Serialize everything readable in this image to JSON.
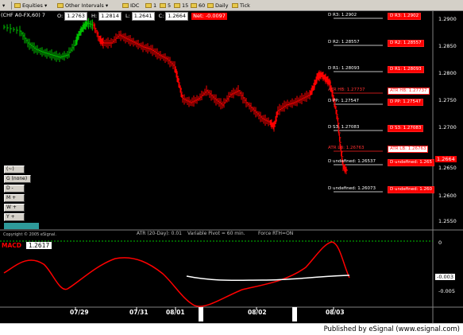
{
  "toolbar": {
    "equities": "Equities",
    "other_intervals": "Other Intervals",
    "intervals": [
      "IDC",
      "1",
      "5",
      "15",
      "60",
      "Daily",
      "Tick"
    ]
  },
  "symbol": {
    "title": "(CHF A0-FX,60) 7",
    "open_label": "O:",
    "open": "1.2763",
    "high_label": "H:",
    "high": "1.2814",
    "low_label": "L:",
    "low": "1.2641",
    "close_label": "C:",
    "close": "1.2664",
    "net_label": "Net:",
    "net": "-0.0097"
  },
  "levels": {
    "r3": {
      "label": "D R3:",
      "value": "1.2902",
      "tag": "D R3:  1.2902"
    },
    "r2": {
      "label": "D R2:",
      "value": "1.28557",
      "tag": "D R2: 1.28557"
    },
    "r1": {
      "label": "D R1:",
      "value": "1.28093",
      "tag": "D R1: 1.28093"
    },
    "atr_hb": {
      "label": "ATR HB:",
      "value": "1.27737",
      "tag": "ATR HB: 1.27737"
    },
    "pp": {
      "label": "D PP:",
      "value": "1.27547",
      "tag": "D PP: 1.27547"
    },
    "s3": {
      "label": "D S3:",
      "value": "1.27083",
      "tag": "D S3: 1.27083"
    },
    "atr_lb": {
      "label": "ATR LB:",
      "value": "1.26763",
      "tag": "ATR LB: 1.26763"
    },
    "und1": {
      "label": "D undefined:",
      "value": "1.26537",
      "tag": "D undefined: 1.265"
    },
    "und2": {
      "label": "D undefined:",
      "value": "1.26073",
      "tag": "D undefined: 1.260"
    }
  },
  "price_axis": [
    "1.2900",
    "1.2850",
    "1.2800",
    "1.2750",
    "1.2700",
    "1.2650",
    "1.2600",
    "1.2550"
  ],
  "last_price_tag": "1.2664",
  "study_buttons": [
    "(~)",
    "G (none)",
    "D  -",
    "M  +",
    "W  +",
    "Y  +"
  ],
  "study_info": {
    "atr": "ATR (20-Day): 0.01",
    "pivot": "Variable Pivot = 60 min.",
    "force": "Force RTH=ON",
    "copyright": "Copyright © 2005 eSignal."
  },
  "macd": {
    "label": "MACD",
    "value": "1.2617",
    "axis": [
      "0",
      "-0.005"
    ],
    "tag": "-0.003"
  },
  "time_axis": [
    "07/29",
    "07/31",
    "08/01",
    "08/02",
    "08/03"
  ],
  "footer": "Published by eSignal (www.esignal.com)",
  "colors": {
    "up_bar": "#00c000",
    "down_bar": "#ff0000",
    "macd": "#ff0000",
    "signal": "#ffffff",
    "zero": "#00c000"
  }
}
